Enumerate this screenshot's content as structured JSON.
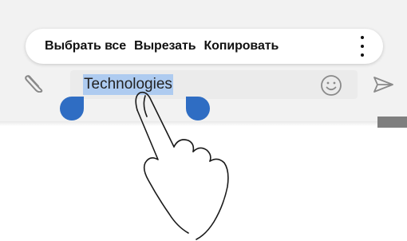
{
  "context_menu": {
    "items": [
      "Выбрать все",
      "Вырезать",
      "Копировать"
    ],
    "more_icon": "more-vertical-icon"
  },
  "composer": {
    "input_value": "Technologies",
    "selected_text": "Technologies",
    "attach_icon": "paperclip-icon",
    "emoji_icon": "smiley-icon",
    "send_icon": "send-icon"
  },
  "colors": {
    "selection_highlight": "#aecbf0",
    "selection_handle": "#2f6dc3",
    "input_background": "#ebebeb"
  },
  "illustration": {
    "gesture_icon": "finger-tap-icon"
  }
}
